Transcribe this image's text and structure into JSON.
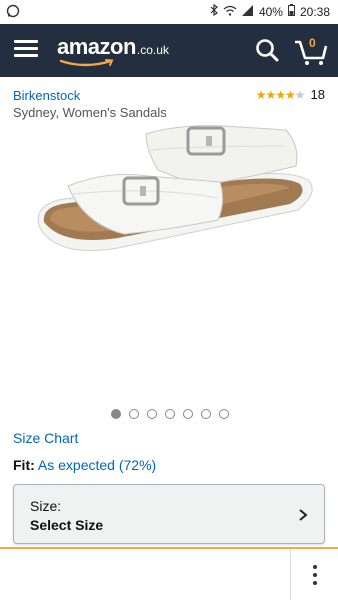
{
  "status_bar": {
    "battery": "40%",
    "time": "20:38",
    "app_icon": "whatsapp-icon"
  },
  "app_bar": {
    "logo_brand": "amazon",
    "logo_tld": ".co.uk",
    "cart_count": "0",
    "colors": {
      "background": "#232f3e",
      "accent": "#f3a847"
    }
  },
  "product": {
    "brand": "Birkenstock",
    "title": "Sydney, Women's Sandals",
    "rating_stars": 4,
    "rating_count": "18",
    "image_count": 7,
    "active_image": 0
  },
  "size_chart_label": "Size Chart",
  "fit": {
    "label": "Fit:",
    "value": "As expected (72%)"
  },
  "size_selector": {
    "label": "Size:",
    "value": "Select Size"
  }
}
